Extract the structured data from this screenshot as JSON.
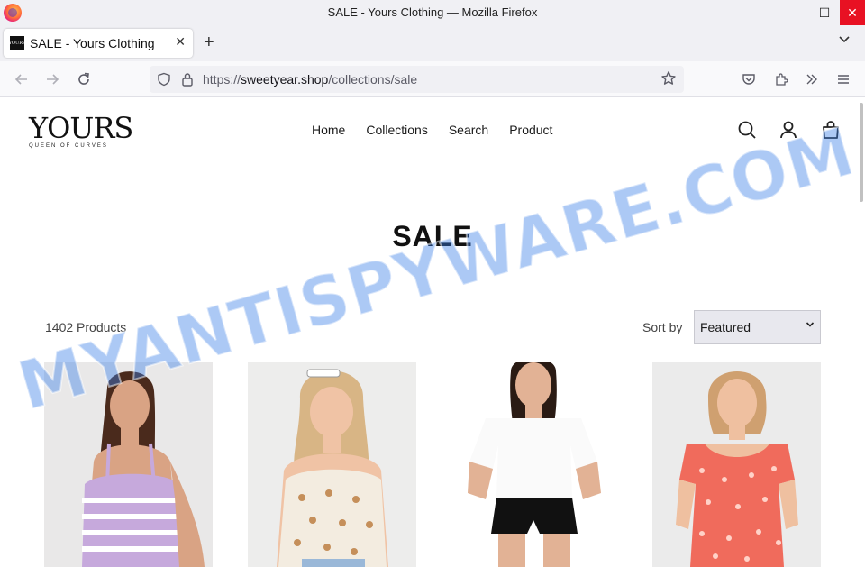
{
  "window": {
    "title": "SALE - Yours Clothing — Mozilla Firefox",
    "minimize_glyph": "–",
    "maximize_glyph": "☐",
    "close_glyph": "✕"
  },
  "tab": {
    "title": "SALE - Yours Clothing",
    "favicon_text": "YOURS",
    "close_glyph": "✕",
    "new_tab_glyph": "+",
    "list_glyph": "⌄"
  },
  "toolbar": {
    "url_prefix": "https://",
    "url_domain": "sweetyear.shop",
    "url_path": "/collections/sale"
  },
  "site": {
    "logo": "YOURS",
    "tagline": "QUEEN OF CURVES",
    "nav": [
      "Home",
      "Collections",
      "Search",
      "Product"
    ],
    "page_title": "SALE",
    "product_count": "1402 Products",
    "sort_label": "Sort by",
    "sort_value": "Featured"
  },
  "products": [
    {
      "top": "lilac and white striped vest top",
      "skin": "#d9a384",
      "hair": "#4a2a1c",
      "garment": "#c6a9dc",
      "stripe": "#ffffff"
    },
    {
      "top": "floral print cami top",
      "skin": "#f0c3a5",
      "hair": "#d8b585",
      "garment": "#f3ece0",
      "stripe": "#c58f5a"
    },
    {
      "top": "white t-shirt and black shorts",
      "skin": "#e2b295",
      "hair": "#2a1b14",
      "garment": "#fafafa",
      "stripe": "#111111"
    },
    {
      "top": "coral floral smock dress",
      "skin": "#efc0a0",
      "hair": "#cfa070",
      "garment": "#f06b5c",
      "stripe": "#ffd2c8"
    }
  ],
  "watermark": "MYANTISPYWARE.COM",
  "colors": {
    "chrome_bg": "#f0f0f4",
    "urlbar_bg": "#f0f0f4",
    "close_red": "#e81123",
    "watermark_blue": "#3a7fe8"
  },
  "icons": [
    "firefox-logo-icon",
    "back-arrow-icon",
    "forward-arrow-icon",
    "reload-icon",
    "shield-icon",
    "lock-icon",
    "star-icon",
    "pocket-icon",
    "extensions-icon",
    "overflow-icon",
    "hamburger-menu-icon",
    "search-icon",
    "account-icon",
    "cart-icon",
    "chevron-down-icon"
  ]
}
